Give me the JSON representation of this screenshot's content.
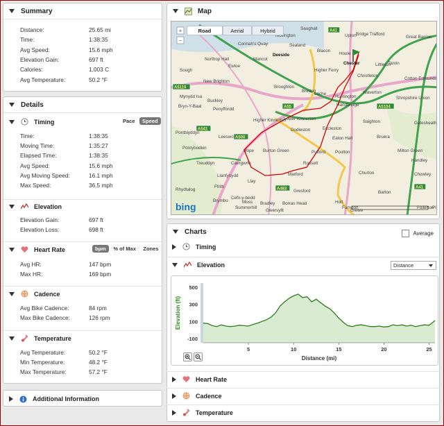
{
  "summary": {
    "title": "Summary",
    "rows": [
      {
        "label": "Distance:",
        "value": "25.65 mi"
      },
      {
        "label": "Time:",
        "value": "1:38:35"
      },
      {
        "label": "Avg Speed:",
        "value": "15.6 mph"
      },
      {
        "label": "Elevation Gain:",
        "value": "697 ft"
      },
      {
        "label": "Calories:",
        "value": "1,003 C"
      },
      {
        "label": "Avg Temperature:",
        "value": "50.2 °F"
      }
    ]
  },
  "details": {
    "title": "Details",
    "timing": {
      "title": "Timing",
      "toggle": [
        "Pace",
        "Speed"
      ],
      "active_toggle": "Speed",
      "rows": [
        {
          "label": "Time:",
          "value": "1:38:35"
        },
        {
          "label": "Moving Time:",
          "value": "1:35:27"
        },
        {
          "label": "Elapsed Time:",
          "value": "1:38:35"
        },
        {
          "label": "Avg Speed:",
          "value": "15.6 mph"
        },
        {
          "label": "Avg Moving Speed:",
          "value": "16.1 mph"
        },
        {
          "label": "Max Speed:",
          "value": "36.5 mph"
        }
      ]
    },
    "elevation": {
      "title": "Elevation",
      "rows": [
        {
          "label": "Elevation Gain:",
          "value": "697 ft"
        },
        {
          "label": "Elevation Loss:",
          "value": "698 ft"
        }
      ]
    },
    "heart_rate": {
      "title": "Heart Rate",
      "toggle": [
        "bpm",
        "% of Max",
        "Zones"
      ],
      "active_toggle": "bpm",
      "rows": [
        {
          "label": "Avg HR:",
          "value": "147 bpm"
        },
        {
          "label": "Max HR:",
          "value": "169 bpm"
        }
      ]
    },
    "cadence": {
      "title": "Cadence",
      "rows": [
        {
          "label": "Avg Bike Cadence:",
          "value": "84 rpm"
        },
        {
          "label": "Max Bike Cadence:",
          "value": "126 rpm"
        }
      ]
    },
    "temperature": {
      "title": "Temperature",
      "rows": [
        {
          "label": "Avg Temperature:",
          "value": "50.2 °F"
        },
        {
          "label": "Min Temperature:",
          "value": "48.2 °F"
        },
        {
          "label": "Max Temperature:",
          "value": "57.2 °F"
        }
      ]
    }
  },
  "additional": {
    "title": "Additional Information"
  },
  "map": {
    "title": "Map",
    "types": [
      "Road",
      "Aerial",
      "Hybrid"
    ],
    "active_type": "Road",
    "logo": "bing",
    "labels": [
      "Saughall",
      "Mollington",
      "Upton",
      "Bridge Trafford",
      "Great Barrow",
      "Connah's Quay",
      "Sealand",
      "Blacon",
      "Hoole",
      "Deeside",
      "Mancot",
      "Chester",
      "Littleton",
      "Tarvin",
      "Northop Hall",
      "Ewloe",
      "Higher Ferry",
      "Christleton",
      "Cotton Edmunds",
      "Sough",
      "New Brighton",
      "Broughton",
      "Bretton",
      "Lache",
      "Huntington",
      "Waverton",
      "Mynydd Isa",
      "Buckley",
      "Handbridge",
      "Shropshire Union",
      "Bryn-Y-Baal",
      "Penyffordd",
      "Higher Kinnerton",
      "Lower Kinnerton",
      "Dodleston",
      "Eccleston",
      "Saighton",
      "Gatesheath",
      "Pontblyddyn",
      "Leeswood",
      "Eaton Hall",
      "Bruera",
      "Hope",
      "Burton Green",
      "Pulford",
      "Poulton",
      "Milton Green",
      "Pontybodkin",
      "Caergwrle",
      "Rossett",
      "Handley",
      "Treuddyn",
      "Llanfynydd",
      "Churton",
      "Chowley",
      "Ffrith",
      "Llay",
      "Marford",
      "Gresford",
      "Barton",
      "Rhydtalog",
      "Cefn-y-bedd",
      "Summerhill",
      "Borras Head",
      "Brymbo",
      "Moss",
      "Bradley",
      "Holt",
      "Gwersyllt",
      "Crewe",
      "Farndon",
      "Fullerton",
      "Pl"
    ],
    "road_labels": [
      "A41",
      "A5119",
      "A55",
      "A541",
      "A5104",
      "A500",
      "A483",
      "A41"
    ],
    "route_color": "#d40000"
  },
  "charts": {
    "title": "Charts",
    "average_label": "Average",
    "timing_title": "Timing",
    "elevation_title": "Elevation",
    "x_axis_select": "Distance",
    "heart_rate_title": "Heart Rate",
    "cadence_title": "Cadence",
    "temperature_title": "Temperature"
  },
  "chart_data": {
    "type": "area",
    "title": "",
    "xlabel": "Distance (mi)",
    "ylabel": "Elevation (ft)",
    "xlim": [
      0,
      25.65
    ],
    "ylim": [
      -150,
      550
    ],
    "xticks": [
      5,
      10,
      15,
      20,
      25
    ],
    "yticks": [
      -100,
      100,
      300,
      500
    ],
    "grid": false,
    "color": "#2f7d1a",
    "x": [
      0,
      0.5,
      1,
      1.5,
      2,
      2.5,
      3,
      3.5,
      4,
      4.5,
      5,
      5.5,
      6,
      6.5,
      7,
      7.5,
      8,
      8.5,
      9,
      9.5,
      10,
      10.5,
      11,
      11.5,
      12,
      12.5,
      13,
      13.5,
      14,
      14.5,
      15,
      15.5,
      16,
      16.5,
      17,
      17.5,
      18,
      18.5,
      19,
      19.5,
      20,
      20.5,
      21,
      21.5,
      22,
      22.5,
      23,
      23.5,
      24,
      24.5,
      25,
      25.65
    ],
    "values": [
      80,
      75,
      50,
      40,
      60,
      45,
      40,
      45,
      55,
      50,
      45,
      65,
      80,
      100,
      120,
      150,
      200,
      280,
      330,
      370,
      400,
      420,
      380,
      390,
      330,
      360,
      320,
      280,
      250,
      200,
      140,
      90,
      50,
      40,
      55,
      60,
      50,
      40,
      40,
      45,
      35,
      40,
      60,
      50,
      60,
      45,
      55,
      40,
      50,
      60,
      55,
      110
    ]
  }
}
